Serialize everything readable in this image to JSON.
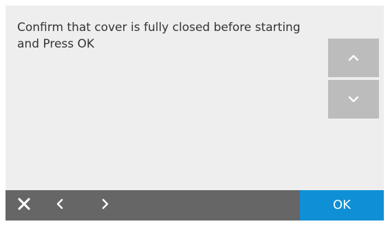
{
  "message": {
    "text": "Confirm that cover is fully closed before starting and Press OK"
  },
  "scroll": {
    "up_icon": "chevron-up-icon",
    "down_icon": "chevron-down-icon"
  },
  "bottom_bar": {
    "close_icon": "close-icon",
    "back_icon": "chevron-left-icon",
    "forward_icon": "chevron-right-icon",
    "ok_label": "OK"
  },
  "colors": {
    "background": "#eeeeee",
    "scroll_button": "#bcbcbc",
    "bottom_bar": "#666666",
    "ok_button": "#0f8fd6",
    "text": "#333333"
  }
}
